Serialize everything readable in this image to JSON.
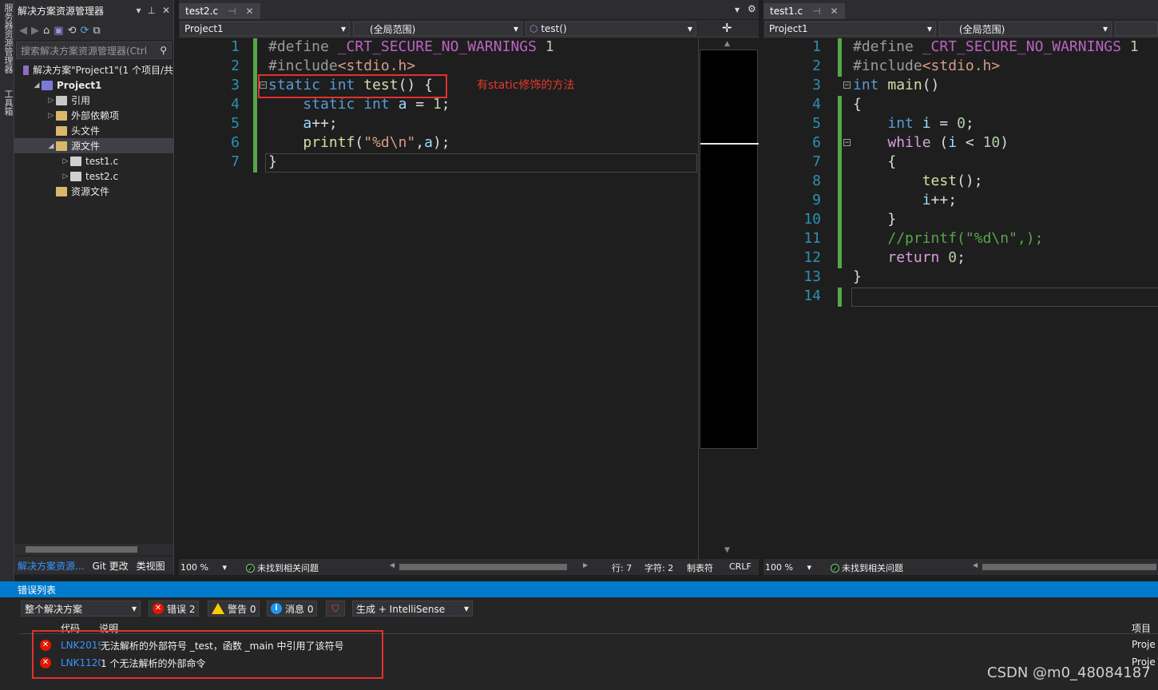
{
  "side_strip": {
    "label_top": "服务器资源管理器",
    "label_bottom": "工具箱"
  },
  "solution_explorer": {
    "title": "解决方案资源管理器",
    "search_placeholder": "搜索解决方案资源管理器(Ctrl",
    "tree": [
      {
        "label": "解决方案\"Project1\"(1 个项目/共",
        "indent": 0,
        "arrow": "",
        "icon": "solution-icon",
        "color": "#8f6dbf",
        "bold": false,
        "selected": false
      },
      {
        "label": "Project1",
        "indent": 1,
        "arrow": "◢",
        "icon": "project-icon",
        "color": "#7a7ad6",
        "bold": true,
        "selected": false
      },
      {
        "label": "引用",
        "indent": 2,
        "arrow": "▷",
        "icon": "references-icon",
        "color": "#c8c8c8",
        "bold": false,
        "selected": false
      },
      {
        "label": "外部依赖项",
        "indent": 2,
        "arrow": "▷",
        "icon": "external-deps-icon",
        "color": "#d9b86b",
        "bold": false,
        "selected": false
      },
      {
        "label": "头文件",
        "indent": 2,
        "arrow": "",
        "icon": "filter-folder-icon",
        "color": "#d9b86b",
        "bold": false,
        "selected": false
      },
      {
        "label": "源文件",
        "indent": 2,
        "arrow": "◢",
        "icon": "filter-folder-icon",
        "color": "#d9b86b",
        "bold": false,
        "selected": true
      },
      {
        "label": "test1.c",
        "indent": 3,
        "arrow": "▷",
        "icon": "c-file-icon",
        "color": "#d0d0d0",
        "bold": false,
        "selected": false
      },
      {
        "label": "test2.c",
        "indent": 3,
        "arrow": "▷",
        "icon": "c-file-icon",
        "color": "#d0d0d0",
        "bold": false,
        "selected": false
      },
      {
        "label": "资源文件",
        "indent": 2,
        "arrow": "",
        "icon": "filter-folder-icon",
        "color": "#d9b86b",
        "bold": false,
        "selected": false
      }
    ],
    "bottom_tabs": [
      "解决方案资源...",
      "Git 更改",
      "类视图"
    ]
  },
  "left_editor": {
    "tab": "test2.c",
    "nav": {
      "project": "Project1",
      "scope": "(全局范围)",
      "member": "test()"
    },
    "lines": [
      [
        [
          "pp",
          "#define "
        ],
        [
          "mac",
          "_CRT_SECURE_NO_WARNINGS"
        ],
        [
          "num",
          " 1"
        ]
      ],
      [
        [
          "pp",
          "#include"
        ],
        [
          "str",
          "<stdio.h>"
        ]
      ],
      [
        [
          "kw",
          "static"
        ],
        [
          "txt",
          " "
        ],
        [
          "kw",
          "int"
        ],
        [
          "txt",
          " "
        ],
        [
          "fn",
          "test"
        ],
        [
          "txt",
          "() {"
        ]
      ],
      [
        [
          "txt",
          "    "
        ],
        [
          "kw",
          "static"
        ],
        [
          "txt",
          " "
        ],
        [
          "kw",
          "int"
        ],
        [
          "txt",
          " "
        ],
        [
          "var",
          "a"
        ],
        [
          "txt",
          " = "
        ],
        [
          "num",
          "1"
        ],
        [
          "txt",
          ";"
        ]
      ],
      [
        [
          "txt",
          "    "
        ],
        [
          "var",
          "a"
        ],
        [
          "txt",
          "++;"
        ]
      ],
      [
        [
          "txt",
          "    "
        ],
        [
          "fn",
          "printf"
        ],
        [
          "txt",
          "("
        ],
        [
          "str",
          "\"%d\\n\""
        ],
        [
          "txt",
          ","
        ],
        [
          "var",
          "a"
        ],
        [
          "txt",
          ");"
        ]
      ],
      [
        [
          "txt",
          "}"
        ]
      ]
    ],
    "annotation": "有static修饰的方法",
    "status": {
      "zoom": "100 %",
      "issues": "未找到相关问题",
      "line": "行: 7",
      "col": "字符: 2",
      "tabs": "制表符",
      "eol": "CRLF"
    }
  },
  "right_editor": {
    "tab": "test1.c",
    "nav": {
      "project": "Project1",
      "scope": "(全局范围)"
    },
    "lines": [
      [
        [
          "pp",
          "#define "
        ],
        [
          "mac",
          "_CRT_SECURE_NO_WARNINGS"
        ],
        [
          "num",
          " 1"
        ]
      ],
      [
        [
          "pp",
          "#include"
        ],
        [
          "str",
          "<stdio.h>"
        ]
      ],
      [
        [
          "kw",
          "int"
        ],
        [
          "txt",
          " "
        ],
        [
          "fn",
          "main"
        ],
        [
          "txt",
          "()"
        ]
      ],
      [
        [
          "txt",
          "{"
        ]
      ],
      [
        [
          "txt",
          "    "
        ],
        [
          "kw",
          "int"
        ],
        [
          "txt",
          " "
        ],
        [
          "var",
          "i"
        ],
        [
          "txt",
          " = "
        ],
        [
          "num",
          "0"
        ],
        [
          "txt",
          ";"
        ]
      ],
      [
        [
          "txt",
          "    "
        ],
        [
          "ctl",
          "while"
        ],
        [
          "txt",
          " ("
        ],
        [
          "var",
          "i"
        ],
        [
          "txt",
          " < "
        ],
        [
          "num",
          "10"
        ],
        [
          "txt",
          ")"
        ]
      ],
      [
        [
          "txt",
          "    {"
        ]
      ],
      [
        [
          "txt",
          "        "
        ],
        [
          "fn",
          "test"
        ],
        [
          "txt",
          "();"
        ]
      ],
      [
        [
          "txt",
          "        "
        ],
        [
          "var",
          "i"
        ],
        [
          "txt",
          "++;"
        ]
      ],
      [
        [
          "txt",
          "    }"
        ]
      ],
      [
        [
          "txt",
          "    "
        ],
        [
          "cmt",
          "//printf(\"%d\\n\",);"
        ]
      ],
      [
        [
          "txt",
          "    "
        ],
        [
          "ctl",
          "return"
        ],
        [
          "txt",
          " "
        ],
        [
          "num",
          "0"
        ],
        [
          "txt",
          ";"
        ]
      ],
      [
        [
          "txt",
          "}"
        ]
      ],
      [
        [
          "txt",
          ""
        ]
      ]
    ],
    "status": {
      "zoom": "100 %",
      "issues": "未找到相关问题"
    }
  },
  "error_list": {
    "title": "错误列表",
    "scope": "整个解决方案",
    "errors_btn": "错误 2",
    "warnings_btn": "警告 0",
    "messages_btn": "消息 0",
    "build_filter": "生成 + IntelliSense",
    "columns": {
      "code": "代码",
      "desc": "说明",
      "project": "项目"
    },
    "rows": [
      {
        "code": "LNK2019",
        "desc": "无法解析的外部符号 _test，函数 _main 中引用了该符号",
        "project": "Proje"
      },
      {
        "code": "LNK1120",
        "desc": "1 个无法解析的外部命令",
        "project": "Proje"
      }
    ]
  },
  "watermark": "CSDN @m0_48084187",
  "colors": {
    "accent": "#007acc",
    "highlight_box": "#e3302f",
    "annotation": "#e8382f",
    "line_number": "#2b91af"
  }
}
